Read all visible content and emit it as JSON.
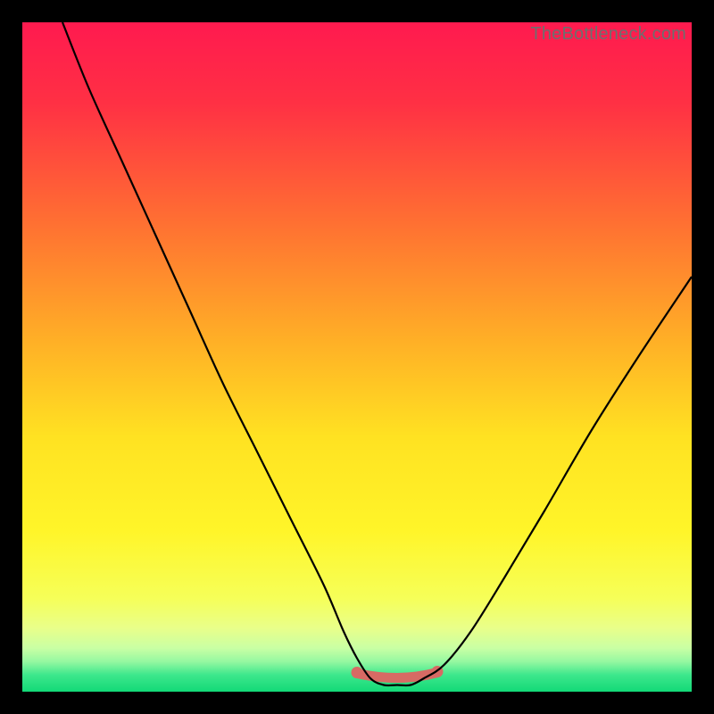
{
  "watermark": "TheBottleneck.com",
  "chart_data": {
    "type": "line",
    "title": "",
    "xlabel": "",
    "ylabel": "",
    "xlim": [
      0,
      100
    ],
    "ylim": [
      0,
      100
    ],
    "x": [
      6,
      10,
      15,
      20,
      25,
      30,
      35,
      40,
      45,
      48,
      50,
      52,
      54,
      56,
      58,
      60,
      63,
      67,
      72,
      78,
      85,
      92,
      100
    ],
    "values": [
      100,
      90,
      79,
      68,
      57,
      46,
      36,
      26,
      16,
      9,
      5,
      2,
      1,
      1,
      1,
      2,
      4,
      9,
      17,
      27,
      39,
      50,
      62
    ],
    "gradient_stops": [
      {
        "offset": 0.0,
        "color": "#ff1a4f"
      },
      {
        "offset": 0.12,
        "color": "#ff3044"
      },
      {
        "offset": 0.3,
        "color": "#ff7032"
      },
      {
        "offset": 0.48,
        "color": "#ffb126"
      },
      {
        "offset": 0.62,
        "color": "#ffe222"
      },
      {
        "offset": 0.76,
        "color": "#fff529"
      },
      {
        "offset": 0.86,
        "color": "#f6ff58"
      },
      {
        "offset": 0.905,
        "color": "#e9ff8a"
      },
      {
        "offset": 0.935,
        "color": "#c9ffa4"
      },
      {
        "offset": 0.955,
        "color": "#95f8a1"
      },
      {
        "offset": 0.975,
        "color": "#3de78c"
      },
      {
        "offset": 1.0,
        "color": "#12d977"
      }
    ],
    "trough_marker": {
      "color": "#d76a64",
      "stroke_width": 11,
      "x_start": 50,
      "x_end": 62,
      "y": 2.2,
      "end_dot_radius": 6.5
    },
    "description": "V-shaped bottleneck curve on vertical rainbow gradient, black outer frame, watermark top-right."
  }
}
